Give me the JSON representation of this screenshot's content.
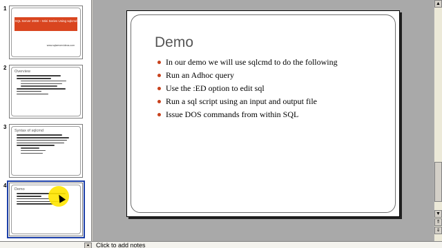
{
  "thumbnails": [
    {
      "number": "1",
      "title": "SQL Server 2008 – Mini Series Using sqlcmd",
      "footer": "www.sqlservervideos.com"
    },
    {
      "number": "2",
      "title": "Overview"
    },
    {
      "number": "3",
      "title": "Syntax of sqlcmd"
    },
    {
      "number": "4",
      "title": "Demo"
    }
  ],
  "slide": {
    "title": "Demo",
    "bullets": [
      "In our demo we will use sqlcmd to do the following",
      "Run an Adhoc query",
      "Use the :ED option to edit sql",
      "Run a sql script using an input and output file",
      "Issue DOS commands from within SQL"
    ]
  },
  "notes": {
    "placeholder": "Click to add notes"
  },
  "scrollbar": {
    "up_icon": "triangle-up",
    "down_icon": "triangle-down",
    "prev_slide_icon": "double-up",
    "next_slide_icon": "double-down"
  },
  "colors": {
    "accent": "#c8411c",
    "selection": "#1c3fa8",
    "cursor_highlight": "#ffe600"
  }
}
